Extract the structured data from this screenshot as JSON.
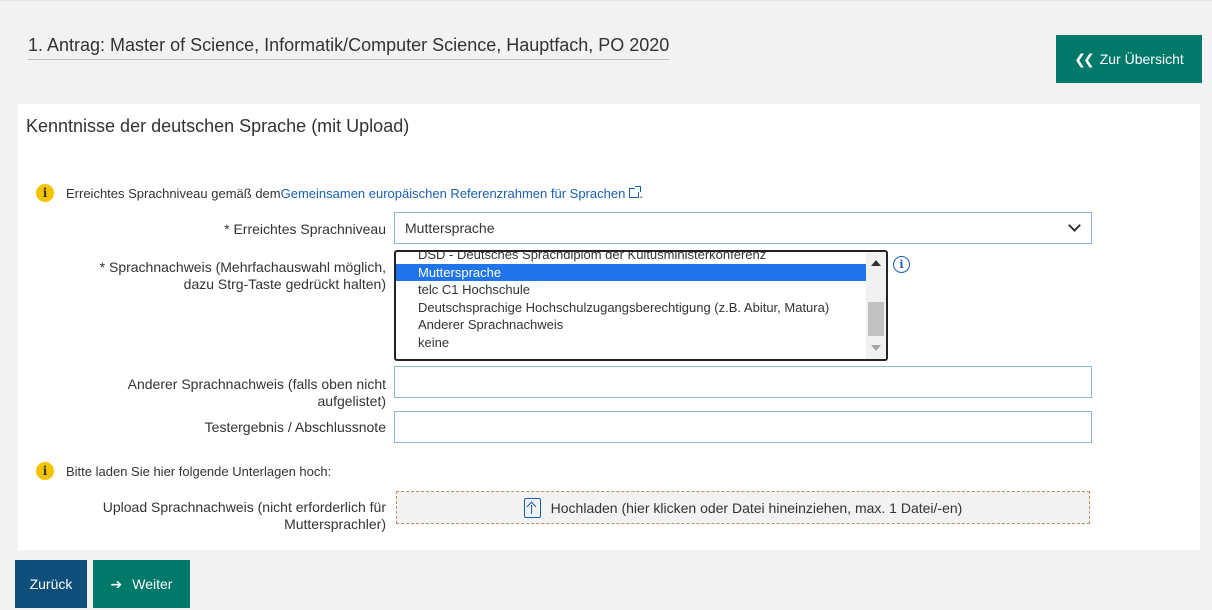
{
  "header": {
    "title": "1. Antrag: Master of Science, Informatik/Computer Science, Hauptfach, PO 2020",
    "overview_button": "Zur Übersicht"
  },
  "section": {
    "title": "Kenntnisse der deutschen Sprache (mit Upload)"
  },
  "info1": {
    "text": "Erreichtes Sprachniveau gemäß dem ",
    "link": "Gemeinsamen europäischen Referenzrahmen für Sprachen",
    "suffix": "."
  },
  "fields": {
    "sprachniveau_label": "* Erreichtes Sprachniveau",
    "sprachniveau_value": "Muttersprache",
    "sprachnachweis_label_1": "* Sprachnachweis (Mehrfachauswahl möglich,",
    "sprachnachweis_label_2": "dazu Strg-Taste gedrückt halten)",
    "sprachnachweis_options": [
      "DSD - Deutsches Sprachdiplom der Kultusministerkonferenz",
      "Muttersprache",
      "telc C1 Hochschule",
      "Deutschsprachige Hochschulzugangsberechtigung (z.B. Abitur, Matura)",
      "Anderer Sprachnachweis",
      "keine"
    ],
    "sprachnachweis_selected": "Muttersprache",
    "anderer_label_1": "Anderer Sprachnachweis (falls oben nicht",
    "anderer_label_2": "aufgelistet)",
    "anderer_value": "",
    "testergebnis_label": "Testergebnis / Abschlussnote",
    "testergebnis_value": ""
  },
  "info2": {
    "text": "Bitte laden Sie hier folgende Unterlagen hoch:"
  },
  "upload": {
    "label_1": "Upload Sprachnachweis (nicht erforderlich für",
    "label_2": "Muttersprachler)",
    "button": "Hochladen (hier klicken oder Datei hineinziehen, max. 1 Datei/-en)"
  },
  "footer": {
    "back": "Zurück",
    "next": "Weiter"
  },
  "colors": {
    "accent_teal": "#00796b",
    "accent_navy": "#0d4f7a",
    "selection_blue": "#1e74e8",
    "info_yellow": "#f5c400",
    "link_blue": "#1a5fb4"
  }
}
